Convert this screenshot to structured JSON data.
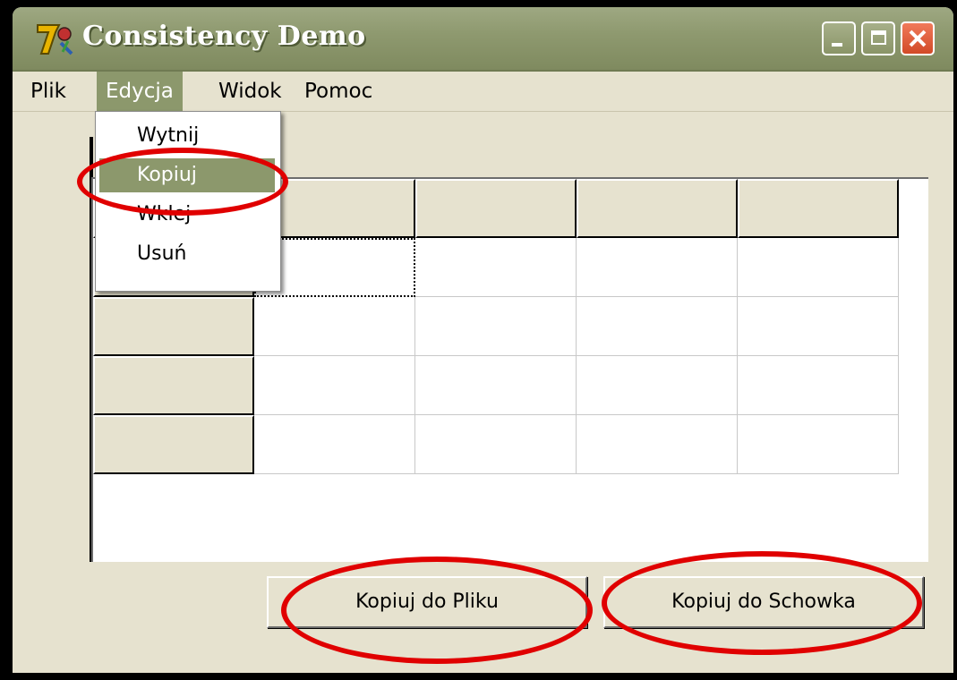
{
  "window": {
    "title": "Consistency Demo",
    "icon": "7-icon",
    "controls": [
      "minimize",
      "maximize",
      "close"
    ]
  },
  "menubar": {
    "items": [
      {
        "label": "Plik"
      },
      {
        "label": "Edycja",
        "active": true
      },
      {
        "label": "Widok"
      },
      {
        "label": "Pomoc"
      }
    ]
  },
  "edit_menu": {
    "items": [
      {
        "label": "Wytnij"
      },
      {
        "label": "Kopiuj",
        "highlighted": true
      },
      {
        "label": "Wklej"
      },
      {
        "label": "Usuń"
      }
    ]
  },
  "grid": {
    "rows": 5,
    "cols": 5,
    "fixed_rows": 1,
    "fixed_cols": 1
  },
  "buttons": {
    "copy_to_file": "Kopiuj do Pliku",
    "copy_to_clipboard": "Kopiuj do Schowka"
  },
  "colors": {
    "titlebar": "#8f9a70",
    "menu_highlight": "#8c986c",
    "window_bg": "#e6e2cf",
    "annotation": "#e00000"
  }
}
